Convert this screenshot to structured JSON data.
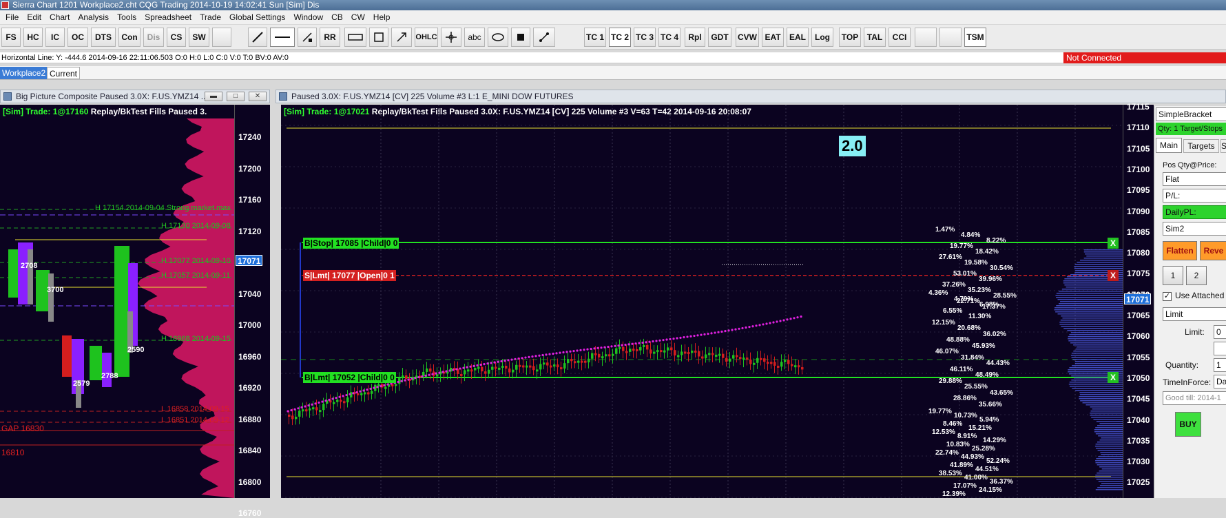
{
  "window": {
    "title": "Sierra Chart 1201 Workplace2.cht  CQG Trading 2014-10-19  14:02:41 Sun [Sim]  Dis"
  },
  "menu": [
    "File",
    "Edit",
    "Chart",
    "Analysis",
    "Tools",
    "Spreadsheet",
    "Trade",
    "Global Settings",
    "Window",
    "CB",
    "CW",
    "Help"
  ],
  "toolbar": {
    "buttons": [
      "FS",
      "HC",
      "IC",
      "OC",
      "DTS",
      "Con",
      "Dis",
      "CS",
      "SW",
      "RR",
      "OHLC",
      "abc",
      "TC 1",
      "TC 2",
      "TC 3",
      "TC 4",
      "Rpl",
      "GDT",
      "CVW",
      "EAT",
      "EAL",
      "Log",
      "TOP",
      "TAL",
      "CCI",
      "TSM"
    ]
  },
  "status": {
    "tool_readout": "Horizontal Line: Y: -444.6  2014-09-16  22:11:06.503  O:0  H:0  L:0  C:0  V:0  T:0  BV:0  AV:0",
    "connection": "Not Connected"
  },
  "tabs": [
    "Workplace2",
    "Current"
  ],
  "left_chart": {
    "caption": "Big Picture Composite  Paused 3.0X: F.US.YMZ14 ...",
    "header_sim": "[Sim]",
    "header_trade": "Trade: 1@17160",
    "header_rest": "Replay/BkTest Fills  Paused 3.",
    "price_labels": [
      "17240",
      "17200",
      "17160",
      "17120",
      "17080",
      "17040",
      "17000",
      "16960",
      "16920",
      "16880",
      "16840",
      "16800",
      "16760"
    ],
    "current_price": "17071",
    "level_notes": [
      {
        "text": "H 17154  2014-09-04  Strong market max",
        "color": "#22c022"
      },
      {
        "text": "H 17130  2014-09-08",
        "color": "#22c022"
      },
      {
        "text": "H 17077  2014-09-10",
        "color": "#22c022"
      },
      {
        "text": "H 17057  2014-09-11",
        "color": "#22c022"
      },
      {
        "text": "H 16968  2014-09-15",
        "color": "#22c022"
      },
      {
        "text": "L 16858  2014-09-15",
        "color": "#e02020"
      },
      {
        "text": "L 16851  2014-09-12",
        "color": "#e02020"
      }
    ],
    "gap_label": "GAP  16830",
    "low_label": "16810",
    "profile_values": [
      "2708",
      "3700",
      "2590",
      "2579",
      "2788"
    ]
  },
  "right_chart": {
    "caption": "Paused 3.0X: F.US.YMZ14 [CV]  225 Volume  #3  L:1  E_MINI DOW FUTURES",
    "header_sim": "[Sim]",
    "header_trade": "Trade: 1@17021",
    "header_rest": "Replay/BkTest Fills  Paused 3.0X: F.US.YMZ14 [CV]  225 Volume  #3 V=63 T=42 2014-09-16 20:08:07",
    "badge": "2.0",
    "price_labels": [
      "17115",
      "17110",
      "17105",
      "17100",
      "17095",
      "17090",
      "17085",
      "17080",
      "17075",
      "17070",
      "17065",
      "17060",
      "17055",
      "17050",
      "17045",
      "17040",
      "17035",
      "17030",
      "17025"
    ],
    "current_price": "17071",
    "orders": [
      {
        "label": "B|Stop| 17085 |Child|0  0",
        "color": "#22e022"
      },
      {
        "label": "S|Lmt| 17077 |Open|0  1",
        "color": "#d42020"
      },
      {
        "label": "B|Lmt| 17052 |Child|0  0",
        "color": "#22e022"
      }
    ],
    "order_close": "X",
    "upper_percentages": [
      "1.47%",
      "4.84%",
      "8.22%",
      "19.77%",
      "18.42%",
      "27.61%",
      "19.58%",
      "30.54%",
      "53.01%",
      "39.96%",
      "37.26%",
      "35.23%",
      "28.55%",
      "22.71%",
      "17.37%"
    ],
    "mid_percentages": [
      "4.36%",
      "4.79%",
      "6.98%",
      "6.55%",
      "11.30%",
      "12.15%",
      "20.68%",
      "36.02%",
      "48.88%",
      "45.93%",
      "46.07%",
      "31.84%",
      "44.43%",
      "46.11%",
      "48.49%",
      "29.88%",
      "25.55%",
      "43.65%",
      "28.86%",
      "35.66%"
    ],
    "lower_percentages": [
      "19.77%",
      "10.73%",
      "5.94%",
      "8.46%",
      "15.21%",
      "12.53%",
      "8.91%",
      "14.29%",
      "10.83%",
      "25.28%",
      "22.74%",
      "44.93%",
      "52.24%",
      "41.89%",
      "44.51%",
      "38.53%",
      "41.00%",
      "36.37%",
      "17.07%",
      "24.15%",
      "12.39%"
    ]
  },
  "trade_panel": {
    "order_type_top": "SimpleBracket",
    "targets": "Qty: 1 Target/Stops",
    "tabs": [
      "Main",
      "Targets",
      "S"
    ],
    "pos_label": "Pos Qty@Price:",
    "position": "Flat",
    "pl_label": "P/L:",
    "daily_pl_label": "DailyPL:",
    "account": "Sim2",
    "flatten": "Flatten",
    "reverse": "Reve",
    "qty1": "1",
    "qty2": "2",
    "use_attached": "Use Attached",
    "order_type": "Limit",
    "limit_label": "Limit:",
    "limit_value": "0",
    "quantity_label": "Quantity:",
    "quantity_value": "1",
    "tif_label": "TimeInForce:",
    "tif_value": "Da",
    "good_till": "Good till: 2014-1",
    "buy": "BUY"
  },
  "colors": {
    "chart_bg": "#0b0320",
    "up_candle": "#1ec21e",
    "down_candle": "#d41e1e",
    "vwap_dots": "#e020e0",
    "profile": "#c0155c",
    "level_line": "#e8e030",
    "current_price_bg": "#1e6fd9"
  }
}
